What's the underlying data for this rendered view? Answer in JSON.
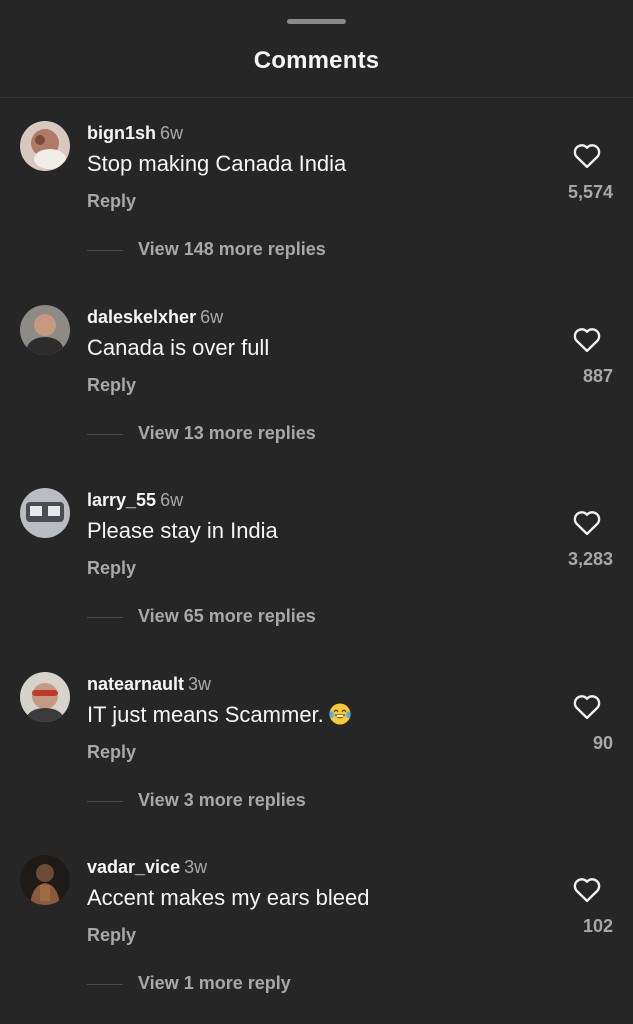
{
  "header": {
    "title": "Comments"
  },
  "comments": [
    {
      "username": "bign1sh",
      "time": "6w",
      "text": "Stop making Canada India",
      "emoji": "",
      "reply_label": "Reply",
      "likes": "5,574",
      "view_replies": "View 148 more replies",
      "avatar_color": "#b07a68"
    },
    {
      "username": "daleskelxher",
      "time": "6w",
      "text": "Canada is over full",
      "emoji": "",
      "reply_label": "Reply",
      "likes": "887",
      "view_replies": "View 13 more replies",
      "avatar_color": "#5f5a55"
    },
    {
      "username": "larry_55",
      "time": "6w",
      "text": "Please stay in India",
      "emoji": "",
      "reply_label": "Reply",
      "likes": "3,283",
      "view_replies": "View 65 more replies",
      "avatar_color": "#6b6e73"
    },
    {
      "username": "natearnault",
      "time": "3w",
      "text": "IT just means Scammer.",
      "emoji": "face-with-tears-of-joy",
      "reply_label": "Reply",
      "likes": "90",
      "view_replies": "View 3 more replies",
      "avatar_color": "#9a8f86"
    },
    {
      "username": "vadar_vice",
      "time": "3w",
      "text": "Accent makes my ears bleed",
      "emoji": "",
      "reply_label": "Reply",
      "likes": "102",
      "view_replies": "View 1 more reply",
      "avatar_color": "#3a2f28"
    }
  ],
  "icons": {
    "like": "heart-outline-icon",
    "handle": "drag-handle"
  },
  "colors": {
    "background": "#262626",
    "primary_text": "#f5f5f5",
    "secondary_text": "#a8a8a8"
  }
}
